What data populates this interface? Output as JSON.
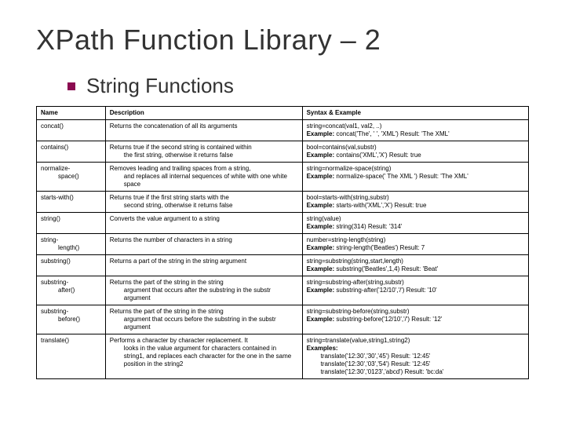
{
  "title": "XPath Function Library – 2",
  "subhead": "String Functions",
  "headers": {
    "name": "Name",
    "description": "Description",
    "syntax": "Syntax & Example"
  },
  "rows": [
    {
      "name": "concat()",
      "desc": "Returns the concatenation of all its arguments",
      "syntax_line1": "string=concat(val1, val2, ..)",
      "example_label": "Example:",
      "example_body": " concat('The', ' ', 'XML')    Result: 'The XML'"
    },
    {
      "name": "contains()",
      "desc_line1": "Returns true if the second string is contained within",
      "desc_rest": "the first string, otherwise it returns false",
      "syntax_line1": "bool=contains(val,substr)",
      "example_label": "Example:",
      "example_body": " contains('XML','X')    Result: true"
    },
    {
      "name_line1": "normalize-",
      "name_rest": "space()",
      "desc_line1": "Removes leading and trailing spaces from a string,",
      "desc_rest": "and replaces all internal sequences of white with one white space",
      "syntax_line1": "string=normalize-space(string)",
      "example_label": "Example:",
      "example_body": " normalize-space(' The   XML ')    Result: 'The XML'"
    },
    {
      "name": "starts-with()",
      "desc_line1": "Returns true if the first string starts with the",
      "desc_rest": "second string, otherwise it returns false",
      "syntax_line1": "bool=starts-with(string,substr)",
      "example_label": "Example:",
      "example_body": " starts-with('XML','X')    Result: true"
    },
    {
      "name": "string()",
      "desc": "Converts the value argument to a string",
      "syntax_line1": "string(value)",
      "example_label": "Example:",
      "example_body": " string(314)    Result: '314'"
    },
    {
      "name_line1": "string-",
      "name_rest": "length()",
      "desc": "Returns the number of characters in a string",
      "syntax_line1": "number=string-length(string)",
      "example_label": "Example:",
      "example_body": " string-length('Beatles')    Result: 7"
    },
    {
      "name": "substring()",
      "desc": "Returns a part of the string in the string argument",
      "syntax_line1": "string=substring(string,start,length)",
      "example_label": "Example:",
      "example_body": " substring('Beatles',1,4)    Result: 'Beat'"
    },
    {
      "name_line1": "substring-",
      "name_rest": "after()",
      "desc_line1": "Returns the part of the string in the string",
      "desc_rest": "argument that occurs after the substring in the substr argument",
      "syntax_line1": "string=substring-after(string,substr)",
      "example_label": "Example:",
      "example_body": " substring-after('12/10','/')    Result: '10'"
    },
    {
      "name_line1": "substring-",
      "name_rest": "before()",
      "desc_line1": "Returns the part of the string in the string",
      "desc_rest": "argument that occurs before the substring in the substr argument",
      "syntax_line1": "string=substring-before(string,substr)",
      "example_label": "Example:",
      "example_body": " substring-before('12/10','/')    Result: '12'"
    },
    {
      "name": "translate()",
      "desc_line1": "Performs a character by character replacement. It",
      "desc_rest": "looks in the value argument for characters contained in string1, and replaces each character for the one in the same position in the string2",
      "syntax_line1": "string=translate(value,string1,string2)",
      "examples_label": "Examples:",
      "example_lines": [
        "translate('12:30','30','45')    Result: '12:45'",
        "translate('12:30','03','54')    Result: '12:45'",
        "translate('12:30','0123','abcd')    Result: 'bc:da'"
      ]
    }
  ]
}
